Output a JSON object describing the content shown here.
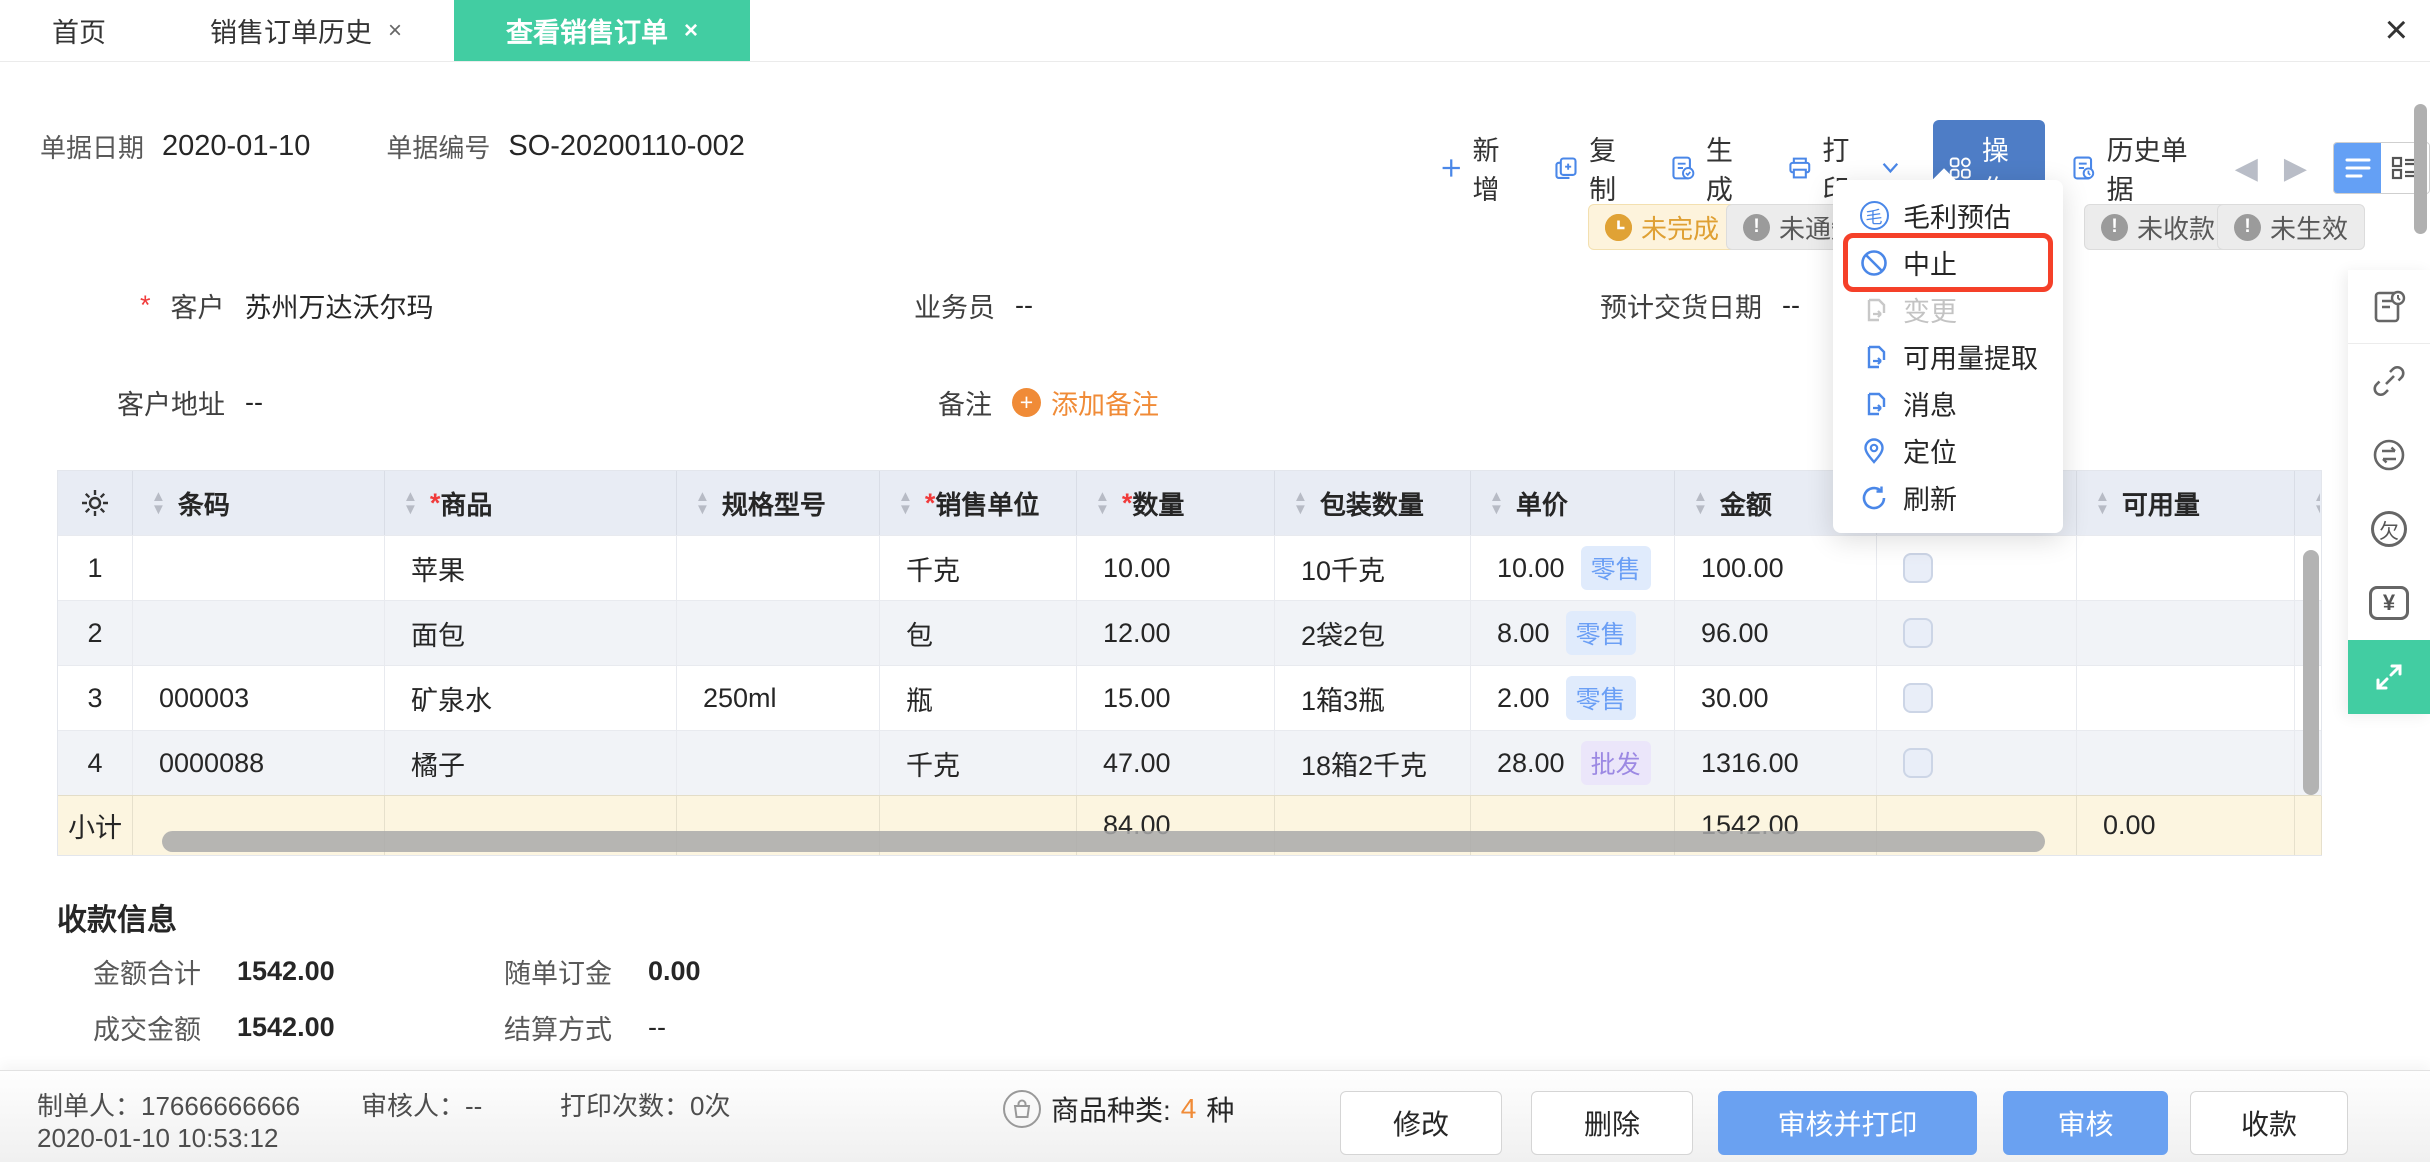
{
  "colors": {
    "teal": "#42cda2",
    "toolbar_blue": "#4a87e8",
    "action_btn": "#4e7dc6",
    "primary_btn": "#6aa1f1",
    "orange": "#f08b37",
    "annotation_red": "#f54029",
    "warning": "#e0a235"
  },
  "tabs": [
    {
      "label": "首页",
      "closable": false,
      "active": false
    },
    {
      "label": "销售订单历史",
      "closable": true,
      "active": false
    },
    {
      "label": "查看销售订单",
      "closable": true,
      "active": true
    }
  ],
  "window": {
    "close": "×"
  },
  "doc": {
    "date_label": "单据日期",
    "date": "2020-01-10",
    "no_label": "单据编号",
    "no": "SO-20200110-002"
  },
  "toolbar": {
    "add": "新增",
    "copy": "复制",
    "generate": "生成",
    "print": "打印",
    "action": "操作",
    "history": "历史单据"
  },
  "status_badges": [
    {
      "label": "未完成"
    },
    {
      "label": "未通知"
    },
    {
      "label": "未收款"
    },
    {
      "label": "未生效"
    }
  ],
  "menu": {
    "items": [
      {
        "label": "毛利预估"
      },
      {
        "label": "中止"
      },
      {
        "label": "变更"
      },
      {
        "label": "可用量提取"
      },
      {
        "label": "消息"
      },
      {
        "label": "定位"
      },
      {
        "label": "刷新"
      }
    ]
  },
  "form": {
    "required_mark": "*",
    "customer_label": "客户",
    "customer": "苏州万达沃尔玛",
    "salesman_label": "业务员",
    "salesman": "--",
    "delivery_label": "预计交货日期",
    "delivery": "--",
    "address_label": "客户地址",
    "address": "--",
    "remark_label": "备注",
    "add_remark": "添加备注"
  },
  "table": {
    "required_mark": "*",
    "headers": [
      {
        "label": "条码"
      },
      {
        "label": "商品"
      },
      {
        "label": "规格型号"
      },
      {
        "label": "销售单位"
      },
      {
        "label": "数量"
      },
      {
        "label": "包装数量"
      },
      {
        "label": "单价"
      },
      {
        "label": "金额"
      },
      {
        "label": "可用量"
      }
    ],
    "rows": [
      {
        "num": "1",
        "barcode": "",
        "product": "苹果",
        "spec": "",
        "unit": "千克",
        "qty": "10.00",
        "pack": "10千克",
        "price": "10.00",
        "price_tag": "零售",
        "amount": "100.00",
        "avail": ""
      },
      {
        "num": "2",
        "barcode": "",
        "product": "面包",
        "spec": "",
        "unit": "包",
        "qty": "12.00",
        "pack": "2袋2包",
        "price": "8.00",
        "price_tag": "零售",
        "amount": "96.00",
        "avail": ""
      },
      {
        "num": "3",
        "barcode": "000003",
        "product": "矿泉水",
        "spec": "250ml",
        "unit": "瓶",
        "qty": "15.00",
        "pack": "1箱3瓶",
        "price": "2.00",
        "price_tag": "零售",
        "amount": "30.00",
        "avail": ""
      },
      {
        "num": "4",
        "barcode": "0000088",
        "product": "橘子",
        "spec": "",
        "unit": "千克",
        "qty": "47.00",
        "pack": "18箱2千克",
        "price": "28.00",
        "price_tag": "批发",
        "amount": "1316.00",
        "avail": ""
      }
    ],
    "subtotal": {
      "label": "小计",
      "qty": "84.00",
      "amount": "1542.00",
      "avail": "0.00"
    }
  },
  "payment": {
    "title": "收款信息",
    "total_label": "金额合计",
    "total": "1542.00",
    "deposit_label": "随单订金",
    "deposit": "0.00",
    "deal_label": "成交金额",
    "deal": "1542.00",
    "settle_label": "结算方式",
    "settle": "--"
  },
  "footer": {
    "creator_label": "制单人：",
    "creator": "17666666666",
    "created_at": "2020-01-10 10:53:12",
    "auditor_label": "审核人：",
    "auditor": "--",
    "print_label": "打印次数：",
    "print_count": "0次",
    "category_label": "商品种类:",
    "category_count": "4",
    "category_unit": "种",
    "buttons": [
      {
        "label": "修改"
      },
      {
        "label": "删除"
      },
      {
        "label": "审核并打印"
      },
      {
        "label": "审核"
      },
      {
        "label": "收款"
      }
    ]
  }
}
